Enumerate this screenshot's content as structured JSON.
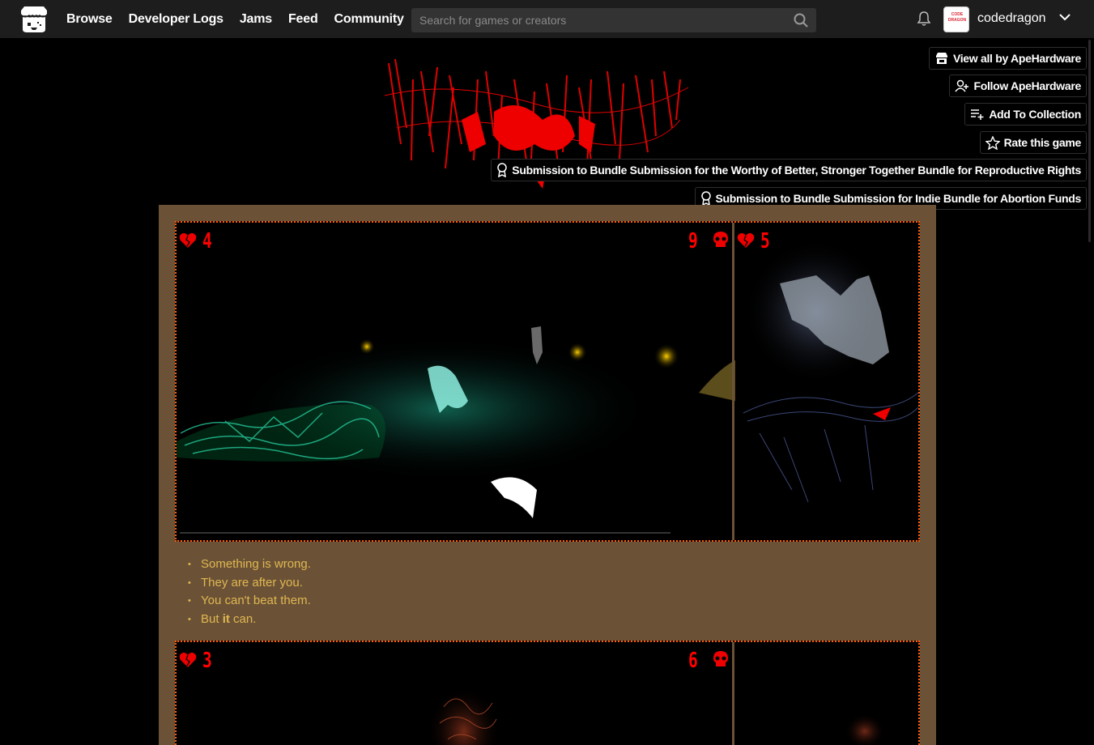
{
  "header": {
    "nav": [
      "Browse",
      "Developer Logs",
      "Jams",
      "Feed",
      "Community"
    ],
    "search_placeholder": "Search for games or creators",
    "username": "codedragon",
    "avatar_text": "CODE DRAGON"
  },
  "actions": {
    "view_all": "View all by ApeHardware",
    "follow": "Follow ApeHardware",
    "add_collection": "Add To Collection",
    "rate": "Rate this game",
    "bundle1": "Submission to Bundle Submission for the Worthy of Better, Stronger Together Bundle for Reproductive Rights",
    "bundle2": "Submission to Bundle Submission for Indie Bundle for Abortion Funds"
  },
  "screenshot1": {
    "left_hud": "4",
    "right_hud_left": "9",
    "right_hud_right": "5"
  },
  "description": {
    "items": [
      "Something is wrong.",
      "They are after you.",
      "You can't beat them."
    ],
    "last_prefix": "But ",
    "last_bold": "it",
    "last_suffix": " can."
  },
  "screenshot2": {
    "left_hud": "3",
    "right_hud": "6"
  },
  "colors": {
    "accent": "#ff0000",
    "column_bg": "#6b5237",
    "dotted_border": "#ff5a0a",
    "text_gold": "#e0b750"
  }
}
